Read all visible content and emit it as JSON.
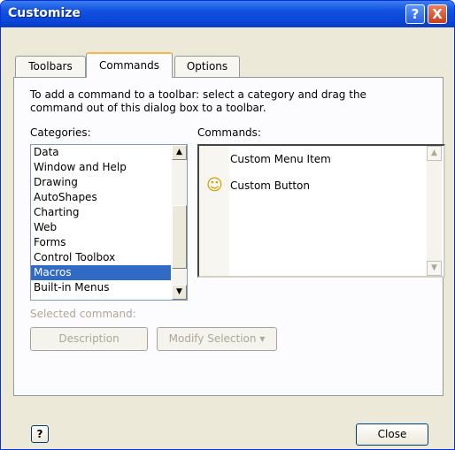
{
  "window": {
    "title": "Customize",
    "help_glyph": "?",
    "close_glyph": "X"
  },
  "tabs": [
    {
      "label": "Toolbars"
    },
    {
      "label": "Commands"
    },
    {
      "label": "Options"
    }
  ],
  "commands_tab": {
    "instructions": "To add a command to a toolbar: select a category and drag the command out of this dialog box to a toolbar.",
    "categories_label": "Categories:",
    "commands_label": "Commands:",
    "categories": [
      "Data",
      "Window and Help",
      "Drawing",
      "AutoShapes",
      "Charting",
      "Web",
      "Forms",
      "Control Toolbox",
      "Macros",
      "Built-in Menus"
    ],
    "selected_category": "Macros",
    "commands": [
      {
        "label": "Custom Menu Item",
        "icon": ""
      },
      {
        "label": "Custom Button",
        "icon": "smiley-icon"
      }
    ],
    "selected_command_label": "Selected command:",
    "description_button": "Description",
    "modify_selection_button": "Modify Selection",
    "modify_selection_arrow": "▾"
  },
  "footer": {
    "help_icon_glyph": "?",
    "close_button": "Close"
  },
  "colors": {
    "selection": "#316ac5",
    "title_bar": "#0a46d8",
    "dialog_bg": "#ece9d8"
  }
}
